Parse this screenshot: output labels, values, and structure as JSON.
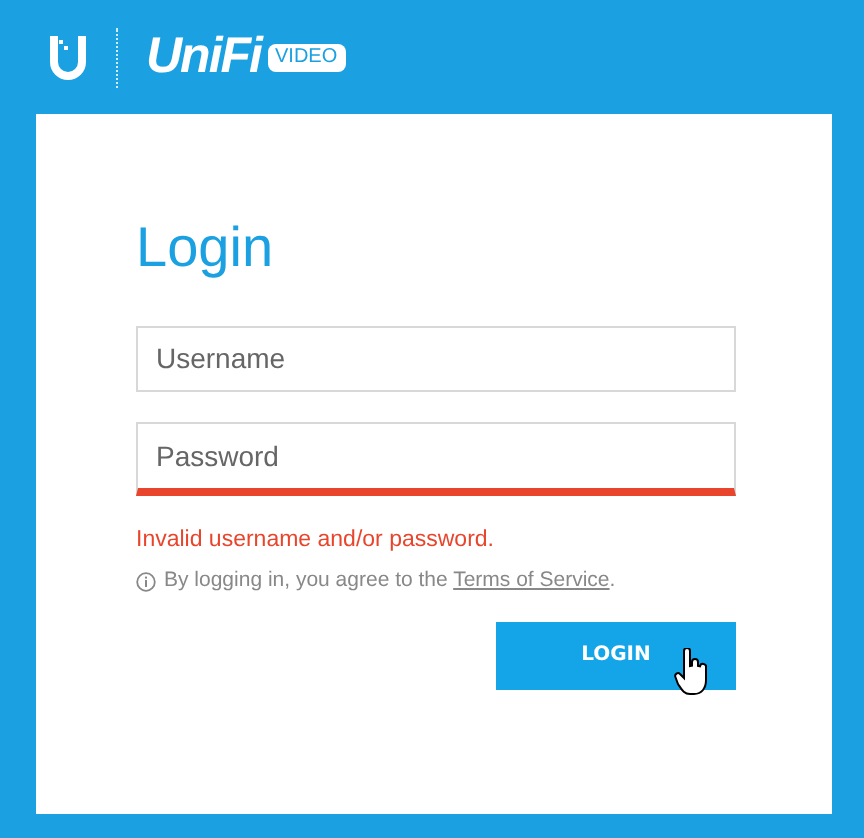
{
  "header": {
    "brand": "UniFi",
    "product": "VIDEO"
  },
  "login": {
    "title": "Login",
    "fields": [
      {
        "placeholder": "Username",
        "error": false
      },
      {
        "placeholder": "Password",
        "error": true
      }
    ],
    "error_message": "Invalid username and/or password.",
    "terms": {
      "text": "By logging in, you agree to the",
      "link": "Terms of Service",
      "end": "."
    },
    "button": {
      "label": "LOGIN",
      "hovered": true
    }
  }
}
